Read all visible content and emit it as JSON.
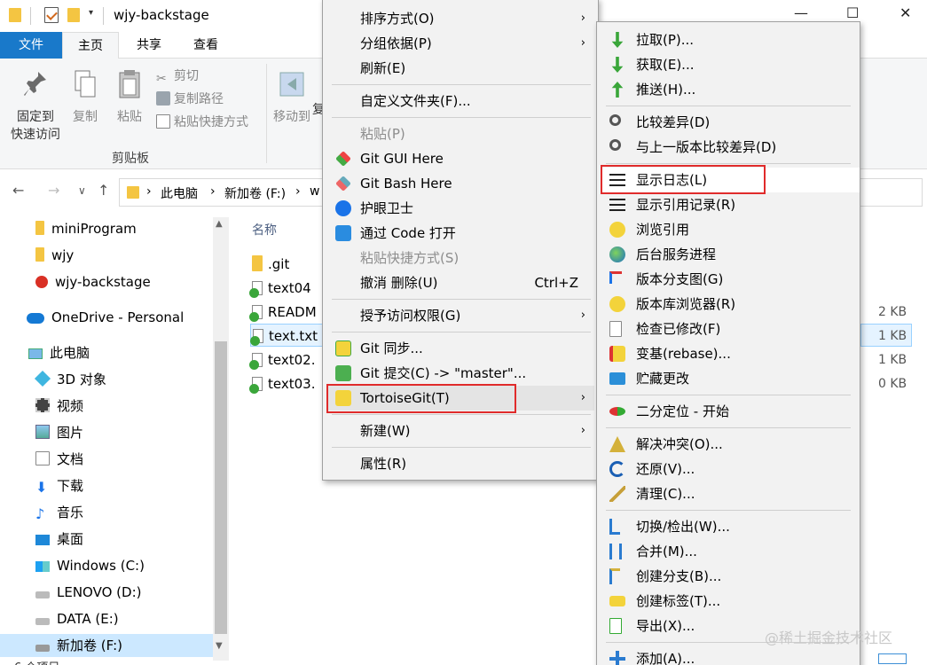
{
  "window": {
    "title": "wjy-backstage",
    "minimize_glyph": "—",
    "maximize_glyph": "☐",
    "close_glyph": "✕",
    "dropdown_glyph": "▾"
  },
  "ribbon_tabs": [
    "文件",
    "主页",
    "共享",
    "查看"
  ],
  "ribbon": {
    "pin_l1": "固定到",
    "pin_l2": "快速访问",
    "copy": "复制",
    "paste": "粘贴",
    "cut": "剪切",
    "copy_path": "复制路径",
    "paste_shortcut": "粘贴快捷方式",
    "clipboard_group": "剪贴板",
    "move_to": "移动到",
    "move_to_cut": "复"
  },
  "address": {
    "back": "←",
    "forward": "→",
    "recent": "∨",
    "up": "↑",
    "sep": "›",
    "parts": [
      "此电脑",
      "新加卷 (F:)",
      "w"
    ]
  },
  "nav": {
    "items": [
      "miniProgram",
      "wjy",
      "wjy-backstage",
      "OneDrive - Personal",
      "此电脑",
      "3D 对象",
      "视频",
      "图片",
      "文档",
      "下载",
      "音乐",
      "桌面",
      "Windows (C:)",
      "LENOVO (D:)",
      "DATA (E:)",
      "新加卷 (F:)"
    ],
    "status": "6 个项目",
    "scroll_up": "▲",
    "scroll_down": "▼"
  },
  "files": {
    "column_name": "名称",
    "rows": [
      ".git",
      "text04",
      "READM",
      "text.txt",
      "text02.",
      "text03."
    ],
    "sizes": [
      "2 KB",
      "1 KB",
      "1 KB",
      "0 KB"
    ]
  },
  "menu1": {
    "items": [
      "排序方式(O)",
      "分组依据(P)",
      "刷新(E)",
      "自定义文件夹(F)...",
      "粘贴(P)",
      "Git GUI Here",
      "Git Bash Here",
      "护眼卫士",
      "通过 Code 打开",
      "粘贴快捷方式(S)",
      "撤消 删除(U)",
      "授予访问权限(G)",
      "Git 同步...",
      "Git 提交(C) -> \"master\"...",
      "TortoiseGit(T)",
      "新建(W)",
      "属性(R)"
    ],
    "undo_shortcut": "Ctrl+Z",
    "arrow": "›"
  },
  "menu2": {
    "items": [
      "拉取(P)...",
      "获取(E)...",
      "推送(H)...",
      "比较差异(D)",
      "与上一版本比较差异(D)",
      "显示日志(L)",
      "显示引用记录(R)",
      "浏览引用",
      "后台服务进程",
      "版本分支图(G)",
      "版本库浏览器(R)",
      "检查已修改(F)",
      "变基(rebase)...",
      "贮藏更改",
      "二分定位 - 开始",
      "解决冲突(O)...",
      "还原(V)...",
      "清理(C)...",
      "切换/检出(W)...",
      "合并(M)...",
      "创建分支(B)...",
      "创建标签(T)...",
      "导出(X)...",
      "添加(A)..."
    ]
  },
  "watermark": "@稀土掘金技术社区"
}
